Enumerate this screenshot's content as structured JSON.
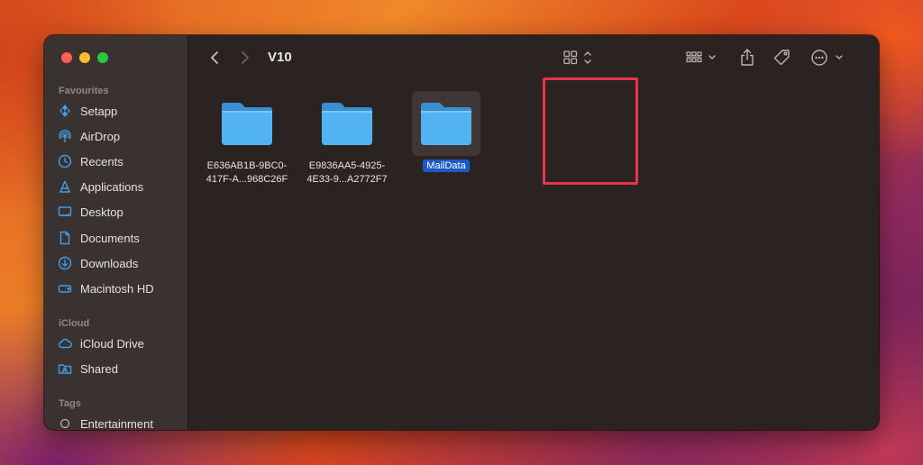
{
  "window": {
    "path_title": "V10"
  },
  "sidebar": {
    "sections": {
      "favourites": "Favourites",
      "icloud": "iCloud",
      "tags": "Tags"
    },
    "favourites": [
      {
        "label": "Setapp",
        "icon": "setapp-icon"
      },
      {
        "label": "AirDrop",
        "icon": "airdrop-icon"
      },
      {
        "label": "Recents",
        "icon": "clock-icon"
      },
      {
        "label": "Applications",
        "icon": "applications-icon"
      },
      {
        "label": "Desktop",
        "icon": "desktop-icon"
      },
      {
        "label": "Documents",
        "icon": "document-icon"
      },
      {
        "label": "Downloads",
        "icon": "download-icon"
      },
      {
        "label": "Macintosh HD",
        "icon": "disk-icon"
      }
    ],
    "icloud": [
      {
        "label": "iCloud Drive",
        "icon": "cloud-icon"
      },
      {
        "label": "Shared",
        "icon": "shared-folder-icon"
      }
    ],
    "tags": [
      {
        "label": "Entertainment",
        "icon": "tag-circle-icon"
      }
    ]
  },
  "files": [
    {
      "name_line1": "E636AB1B-9BC0-",
      "name_line2": "417F-A...968C26F",
      "selected": false
    },
    {
      "name_line1": "E9836AA5-4925-",
      "name_line2": "4E33-9...A2772F7",
      "selected": false
    },
    {
      "name_line1": "MailData",
      "name_line2": "",
      "selected": true
    }
  ],
  "colors": {
    "accent": "#3f9dea",
    "selection": "#1b59c8",
    "highlight_box": "#e8344a"
  }
}
